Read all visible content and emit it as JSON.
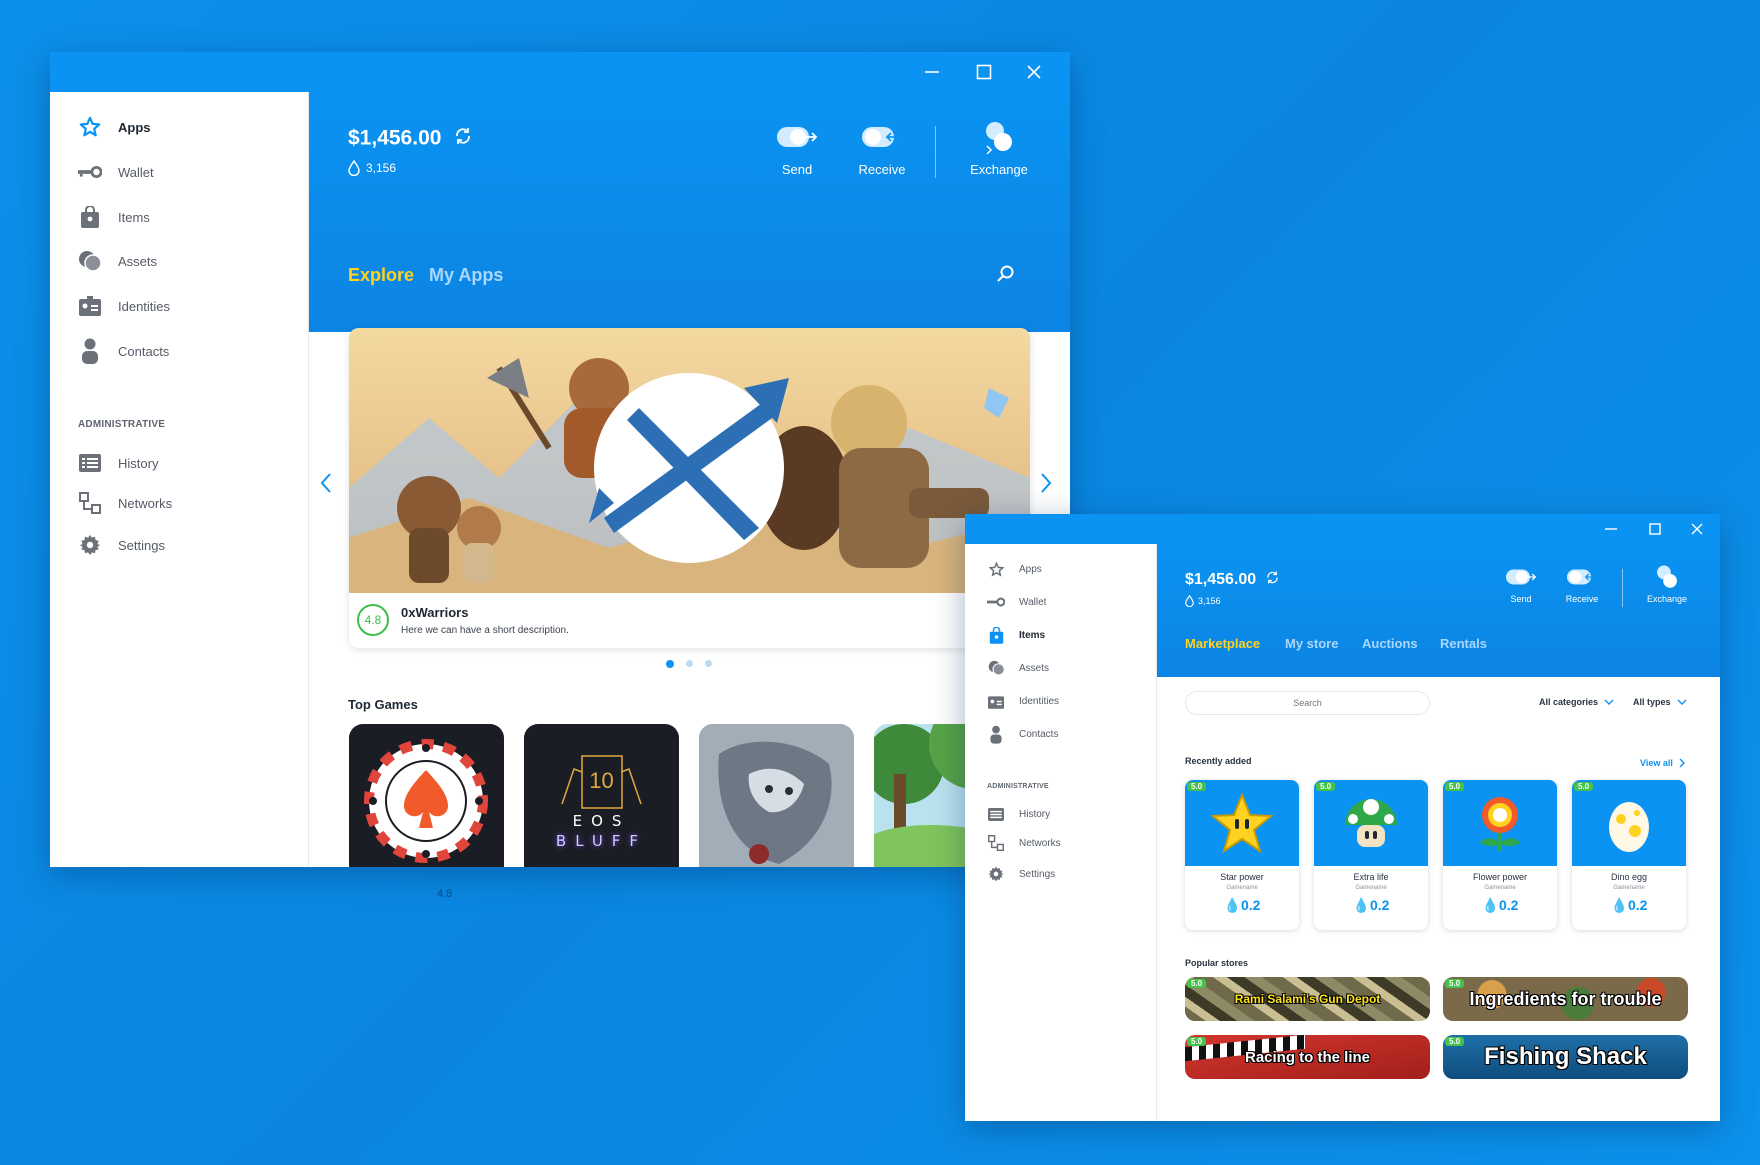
{
  "window1": {
    "sidebar": {
      "items": [
        {
          "label": "Apps",
          "icon": "star-icon",
          "active": true
        },
        {
          "label": "Wallet",
          "icon": "key-icon"
        },
        {
          "label": "Items",
          "icon": "bag-icon"
        },
        {
          "label": "Assets",
          "icon": "coins-icon"
        },
        {
          "label": "Identities",
          "icon": "id-card-icon"
        },
        {
          "label": "Contacts",
          "icon": "person-icon"
        }
      ],
      "admin_heading": "ADMINISTRATIVE",
      "admin_items": [
        {
          "label": "History",
          "icon": "list-icon"
        },
        {
          "label": "Networks",
          "icon": "network-icon"
        },
        {
          "label": "Settings",
          "icon": "gear-icon"
        }
      ]
    },
    "header": {
      "balance": "$1,456.00",
      "tokens": "3,156",
      "actions": [
        "Send",
        "Receive",
        "Exchange"
      ]
    },
    "tabs": [
      "Explore",
      "My Apps"
    ],
    "featured": {
      "rating": "4.8",
      "title": "0xWarriors",
      "description": "Here we can have a short description."
    },
    "top_games_heading": "Top Games",
    "top_games": [
      {
        "name": "poker-chip"
      },
      {
        "name": "eos-bluff",
        "card_number": "10",
        "line1": "EOS",
        "line2": "BLUFF"
      },
      {
        "name": "dragon-art"
      },
      {
        "name": "forest-art"
      }
    ],
    "below_rating": "4.8"
  },
  "window2": {
    "sidebar": {
      "items": [
        {
          "label": "Apps",
          "icon": "star-icon"
        },
        {
          "label": "Wallet",
          "icon": "key-icon"
        },
        {
          "label": "Items",
          "icon": "bag-icon",
          "active": true
        },
        {
          "label": "Assets",
          "icon": "coins-icon"
        },
        {
          "label": "Identities",
          "icon": "id-card-icon"
        },
        {
          "label": "Contacts",
          "icon": "person-icon"
        }
      ],
      "admin_heading": "ADMINISTRATIVE",
      "admin_items": [
        {
          "label": "History",
          "icon": "list-icon"
        },
        {
          "label": "Networks",
          "icon": "network-icon"
        },
        {
          "label": "Settings",
          "icon": "gear-icon"
        }
      ]
    },
    "header": {
      "balance": "$1,456.00",
      "tokens": "3,156",
      "actions": [
        "Send",
        "Receive",
        "Exchange"
      ]
    },
    "tabs": [
      "Marketplace",
      "My store",
      "Auctions",
      "Rentals"
    ],
    "search_placeholder": "Search",
    "filters": [
      "All categories",
      "All types"
    ],
    "recent_heading": "Recently added",
    "view_all": "View all",
    "items": [
      {
        "name": "Star power",
        "game": "Gamename",
        "price": "0.2",
        "badge": "5.0",
        "art": "star"
      },
      {
        "name": "Extra life",
        "game": "Gamename",
        "price": "0.2",
        "badge": "5.0",
        "art": "mushroom"
      },
      {
        "name": "Flower power",
        "game": "Gamename",
        "price": "0.2",
        "badge": "5.0",
        "art": "flower"
      },
      {
        "name": "Dino egg",
        "game": "Gamename",
        "price": "0.2",
        "badge": "5.0",
        "art": "egg"
      }
    ],
    "popular_heading": "Popular stores",
    "stores": [
      {
        "name": "Rami Salami's Gun Depot",
        "badge": "5.0",
        "bg": "camo",
        "color": "#ffe21a"
      },
      {
        "name": "Ingredients for trouble",
        "badge": "5.0",
        "bg": "veg",
        "color": "#ffffff"
      },
      {
        "name": "Racing to the line",
        "badge": "5.0",
        "bg": "racing",
        "color": "#ffffff"
      },
      {
        "name": "Fishing Shack",
        "badge": "5.0",
        "bg": "water",
        "color": "#ffffff"
      }
    ]
  },
  "colors": {
    "accent": "#0a93f2",
    "active_tab": "#ffd21f",
    "rating_green": "#3fbf4a"
  }
}
